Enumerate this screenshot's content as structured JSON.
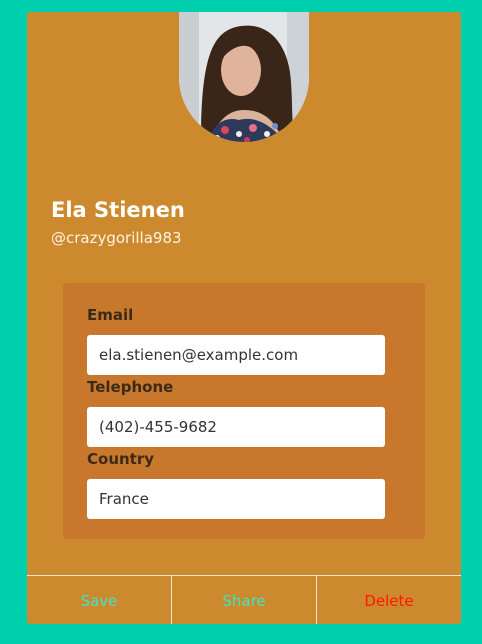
{
  "profile": {
    "name": "Ela Stienen",
    "handle": "@crazygorilla983"
  },
  "fields": {
    "email": {
      "label": "Email",
      "value": "ela.stienen@example.com"
    },
    "telephone": {
      "label": "Telephone",
      "value": "(402)-455-9682"
    },
    "country": {
      "label": "Country",
      "value": "France"
    }
  },
  "actions": {
    "save": "Save",
    "share": "Share",
    "delete": "Delete"
  },
  "colors": {
    "page_background": "#00cfae",
    "card": "#cd892d",
    "panel": "#c8782c",
    "save": "#40e5c4",
    "share": "#40e5c4",
    "delete": "#ff1a00"
  }
}
